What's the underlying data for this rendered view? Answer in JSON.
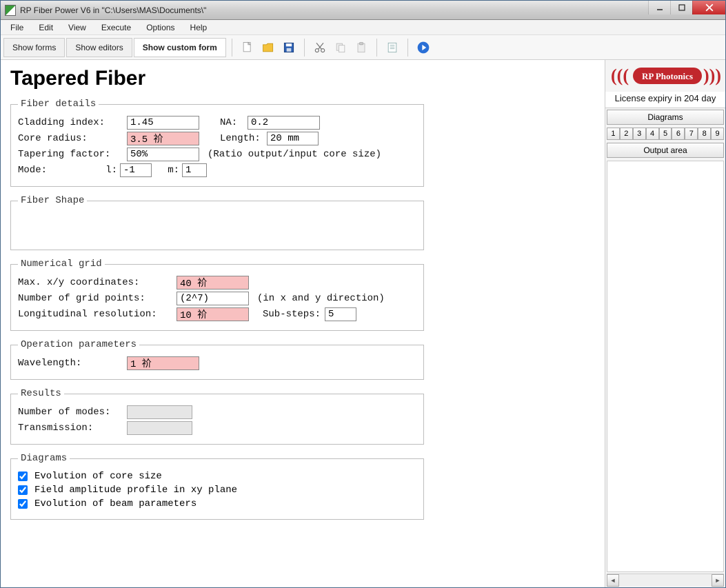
{
  "window": {
    "title": "RP Fiber Power V6 in \"C:\\Users\\MAS\\Documents\\\""
  },
  "menus": [
    "File",
    "Edit",
    "View",
    "Execute",
    "Options",
    "Help"
  ],
  "tool_tabs": {
    "show_forms": "Show forms",
    "show_editors": "Show editors",
    "show_custom": "Show custom form"
  },
  "page": {
    "title": "Tapered Fiber"
  },
  "fiber_details": {
    "legend": "Fiber details",
    "cladding_index_label": "Cladding index:",
    "cladding_index": "1.45",
    "na_label": "NA:",
    "na": "0.2",
    "core_radius_label": "Core radius:",
    "core_radius": "3.5 祄",
    "length_label": "Length:",
    "length": "20 mm",
    "tapering_label": "Tapering factor:",
    "tapering": "50%",
    "tapering_note": "(Ratio output/input core size)",
    "mode_label": "Mode:",
    "mode_l_label": "l:",
    "mode_l": "-1",
    "mode_m_label": "m:",
    "mode_m": "1"
  },
  "fiber_shape": {
    "legend": "Fiber Shape"
  },
  "numerical_grid": {
    "legend": "Numerical grid",
    "maxxy_label": "Max. x/y coordinates:",
    "maxxy": "40 祄",
    "points_label": "Number of grid points:",
    "points": "(2^7)",
    "points_note": "(in x and y direction)",
    "longres_label": "Longitudinal resolution:",
    "longres": "10 祄",
    "substeps_label": "Sub-steps:",
    "substeps": "5"
  },
  "op_params": {
    "legend": "Operation parameters",
    "wavelength_label": "Wavelength:",
    "wavelength": "1 祄"
  },
  "results": {
    "legend": "Results",
    "modes_label": "Number of modes:",
    "modes": "",
    "trans_label": "Transmission:",
    "trans": ""
  },
  "diagrams": {
    "legend": "Diagrams",
    "cb1": "Evolution of core size",
    "cb2": "Field amplitude profile in xy plane",
    "cb3": "Evolution of beam parameters"
  },
  "side": {
    "logo_text": "RP Photonics",
    "license": "License expiry in 204 day",
    "diagrams_btn": "Diagrams",
    "tabs": [
      "1",
      "2",
      "3",
      "4",
      "5",
      "6",
      "7",
      "8",
      "9"
    ],
    "output_btn": "Output area"
  }
}
